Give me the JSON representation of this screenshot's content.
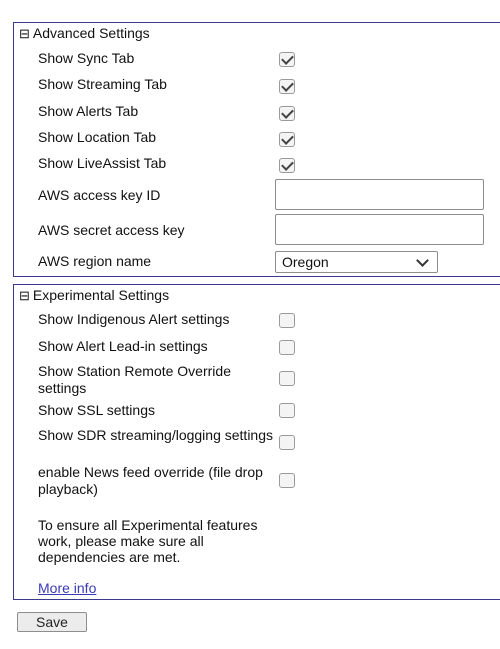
{
  "advanced": {
    "title": "Advanced Settings",
    "collapse_icon": "⊟",
    "checkboxes": [
      {
        "label": "Show Sync Tab",
        "checked": true
      },
      {
        "label": "Show Streaming Tab",
        "checked": true
      },
      {
        "label": "Show Alerts Tab",
        "checked": true
      },
      {
        "label": "Show Location Tab",
        "checked": true
      },
      {
        "label": "Show LiveAssist Tab",
        "checked": true
      }
    ],
    "aws_access_key": {
      "label": "AWS access key ID",
      "value": ""
    },
    "aws_secret_key": {
      "label": "AWS secret access key",
      "value": ""
    },
    "aws_region": {
      "label": "AWS region name",
      "selected": "Oregon"
    }
  },
  "experimental": {
    "title": "Experimental Settings",
    "collapse_icon": "⊟",
    "checkboxes": [
      {
        "label": "Show Indigenous Alert settings",
        "checked": false
      },
      {
        "label": "Show Alert Lead-in settings",
        "checked": false
      },
      {
        "label": "Show Station Remote Override settings",
        "checked": false
      },
      {
        "label": "Show SSL settings",
        "checked": false
      },
      {
        "label": "Show SDR streaming/logging settings",
        "checked": false
      },
      {
        "label": "enable News feed override (file drop playback)",
        "checked": false
      }
    ],
    "note": "To ensure all Experimental features work, please make sure all dependencies are met.",
    "more_info_link": "More info"
  },
  "save_label": "Save"
}
